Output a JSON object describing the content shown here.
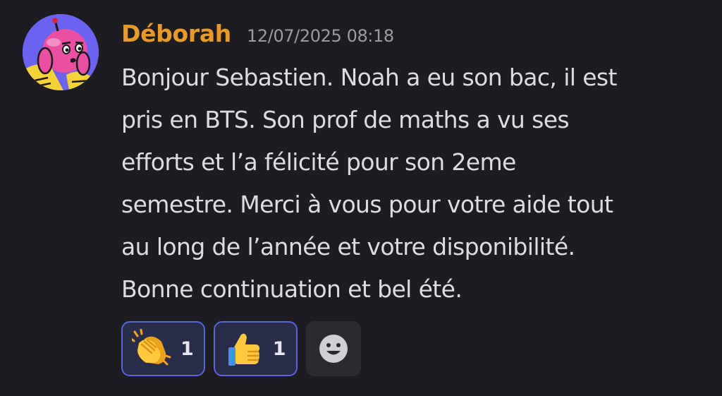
{
  "message": {
    "author": "Déborah",
    "timestamp": "12/07/2025 08:18",
    "author_color": "#e69a29",
    "lines": [
      "Bonjour Sebastien. Noah a eu son bac, il est",
      "pris en BTS. Son prof de maths a vu ses",
      "efforts et l’a félicité pour son 2eme",
      "semestre. Merci à vous pour votre aide tout",
      "au long de l’année et votre disponibilité.",
      "Bonne continuation et bel été."
    ]
  },
  "reactions": [
    {
      "emoji": "clapping-hands",
      "count": "1"
    },
    {
      "emoji": "thumbs-up",
      "count": "1"
    }
  ],
  "add_reaction": {
    "icon": "smiley-face-icon"
  },
  "colors": {
    "background": "#1c1c21",
    "reaction_border": "#5a63e0",
    "reaction_bg": "#2a2d49"
  }
}
